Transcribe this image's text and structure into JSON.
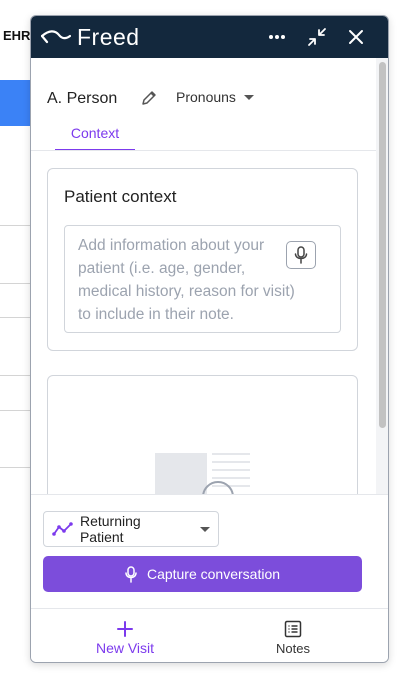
{
  "background": {
    "ehr_label": "EHR"
  },
  "header": {
    "brand": "Freed",
    "more_icon": "more-horizontal-icon",
    "minimize_icon": "minimize-icon",
    "close_icon": "close-icon"
  },
  "patient": {
    "name": "A. Person",
    "pronouns_label": "Pronouns"
  },
  "tabs": [
    {
      "label": "Context",
      "active": true
    }
  ],
  "context_card": {
    "title": "Patient context",
    "placeholder": "Add information about your patient (i.e. age, gender, medical history, reason for visit) to include in their note."
  },
  "footer": {
    "visit_type": "Returning Patient",
    "capture_label": "Capture conversation",
    "nav": [
      {
        "label": "New Visit",
        "icon": "plus-icon",
        "active": true
      },
      {
        "label": "Notes",
        "icon": "notes-icon",
        "active": false
      }
    ]
  },
  "colors": {
    "header_bg": "#13283d",
    "accent": "#7c3aed",
    "capture_bg": "#7c4ddb"
  }
}
